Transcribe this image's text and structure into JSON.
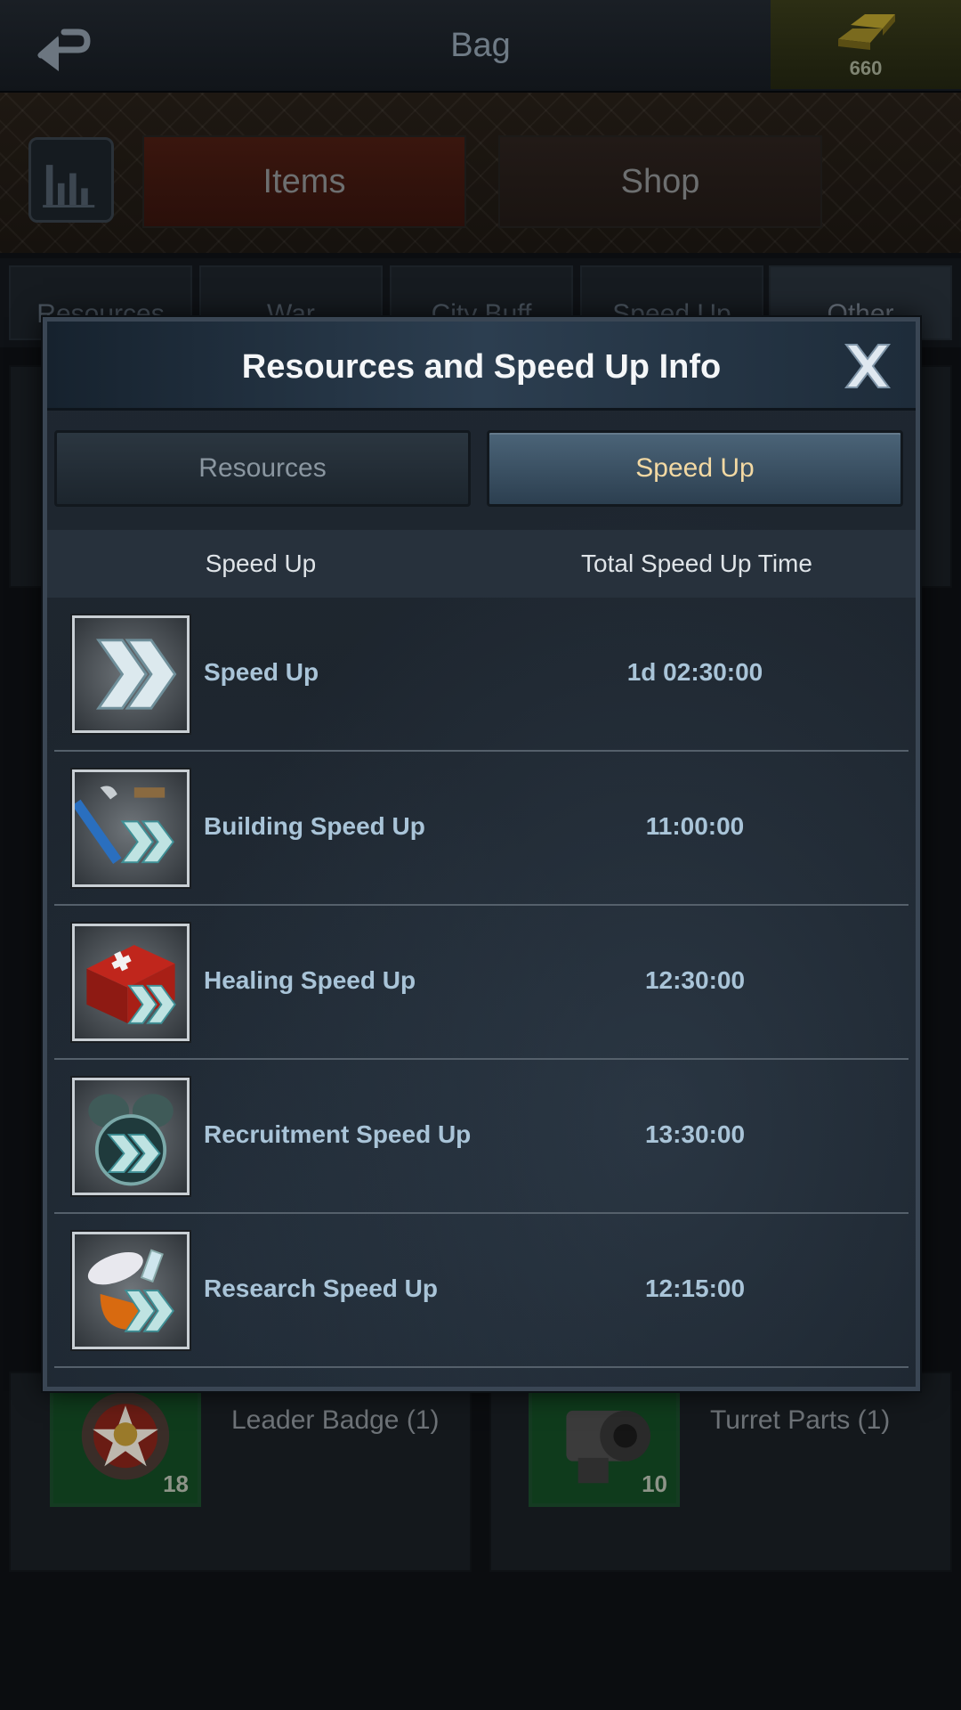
{
  "header": {
    "title": "Bag",
    "gold_amount": "660"
  },
  "main_tabs": {
    "items": "Items",
    "shop": "Shop"
  },
  "sub_tabs": [
    "Resources",
    "War",
    "City Buff",
    "Speed Up",
    "Other"
  ],
  "background_items": [
    {
      "name": "Leader Badge (1)",
      "badge": "1",
      "count": "18",
      "icon": "leader-badge-icon"
    },
    {
      "name": "Turret Parts (1)",
      "badge": "1",
      "count": "10",
      "icon": "turret-parts-icon"
    }
  ],
  "modal": {
    "title": "Resources and Speed Up Info",
    "tabs": {
      "resources": "Resources",
      "speed_up": "Speed Up",
      "active": "speed_up"
    },
    "columns": {
      "name": "Speed Up",
      "time": "Total Speed Up Time"
    },
    "rows": [
      {
        "name": "Speed Up",
        "time": "1d 02:30:00",
        "icon": "speed-up-icon"
      },
      {
        "name": "Building Speed Up",
        "time": "11:00:00",
        "icon": "building-speed-up-icon"
      },
      {
        "name": "Healing Speed Up",
        "time": "12:30:00",
        "icon": "healing-speed-up-icon"
      },
      {
        "name": "Recruitment Speed Up",
        "time": "13:30:00",
        "icon": "recruitment-speed-up-icon"
      },
      {
        "name": "Research Speed Up",
        "time": "12:15:00",
        "icon": "research-speed-up-icon"
      }
    ]
  },
  "colors": {
    "accent_active_tab_text": "#f3d9a3",
    "row_text": "#a9c4d8",
    "items_tab": "#3a160e"
  }
}
